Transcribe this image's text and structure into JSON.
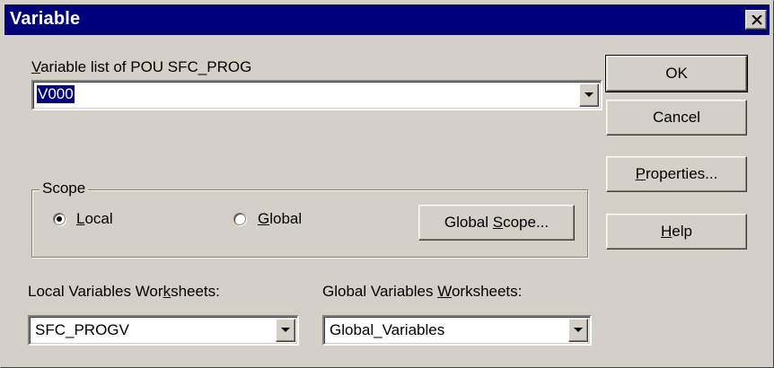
{
  "dialog": {
    "title": "Variable",
    "close_glyph": "✕"
  },
  "variable_list": {
    "label_pre": "",
    "label_accel": "V",
    "label_post": "ariable list of POU SFC_PROG",
    "value": "V000"
  },
  "buttons": {
    "ok": "OK",
    "cancel": "Cancel",
    "properties_accel": "P",
    "properties_rest": "roperties...",
    "help_accel": "H",
    "help_rest": "elp"
  },
  "scope": {
    "legend": "Scope",
    "local_accel": "L",
    "local_rest": "ocal",
    "local_selected": true,
    "global_accel": "G",
    "global_rest": "lobal",
    "global_selected": false,
    "global_scope_pre": "Global ",
    "global_scope_accel": "S",
    "global_scope_post": "cope..."
  },
  "local_worksheets": {
    "label_pre": "Local Variables Wor",
    "label_accel": "k",
    "label_post": "sheets:",
    "value": "SFC_PROGV"
  },
  "global_worksheets": {
    "label_pre": "Global Variables ",
    "label_accel": "W",
    "label_post": "orksheets:",
    "value": "Global_Variables"
  },
  "icons": [
    "close-icon",
    "dropdown-arrow-icon",
    "radio-icon"
  ],
  "colors": {
    "title_bar": "#00007b",
    "face": "#d4d0c8",
    "selection": "#00007b"
  }
}
